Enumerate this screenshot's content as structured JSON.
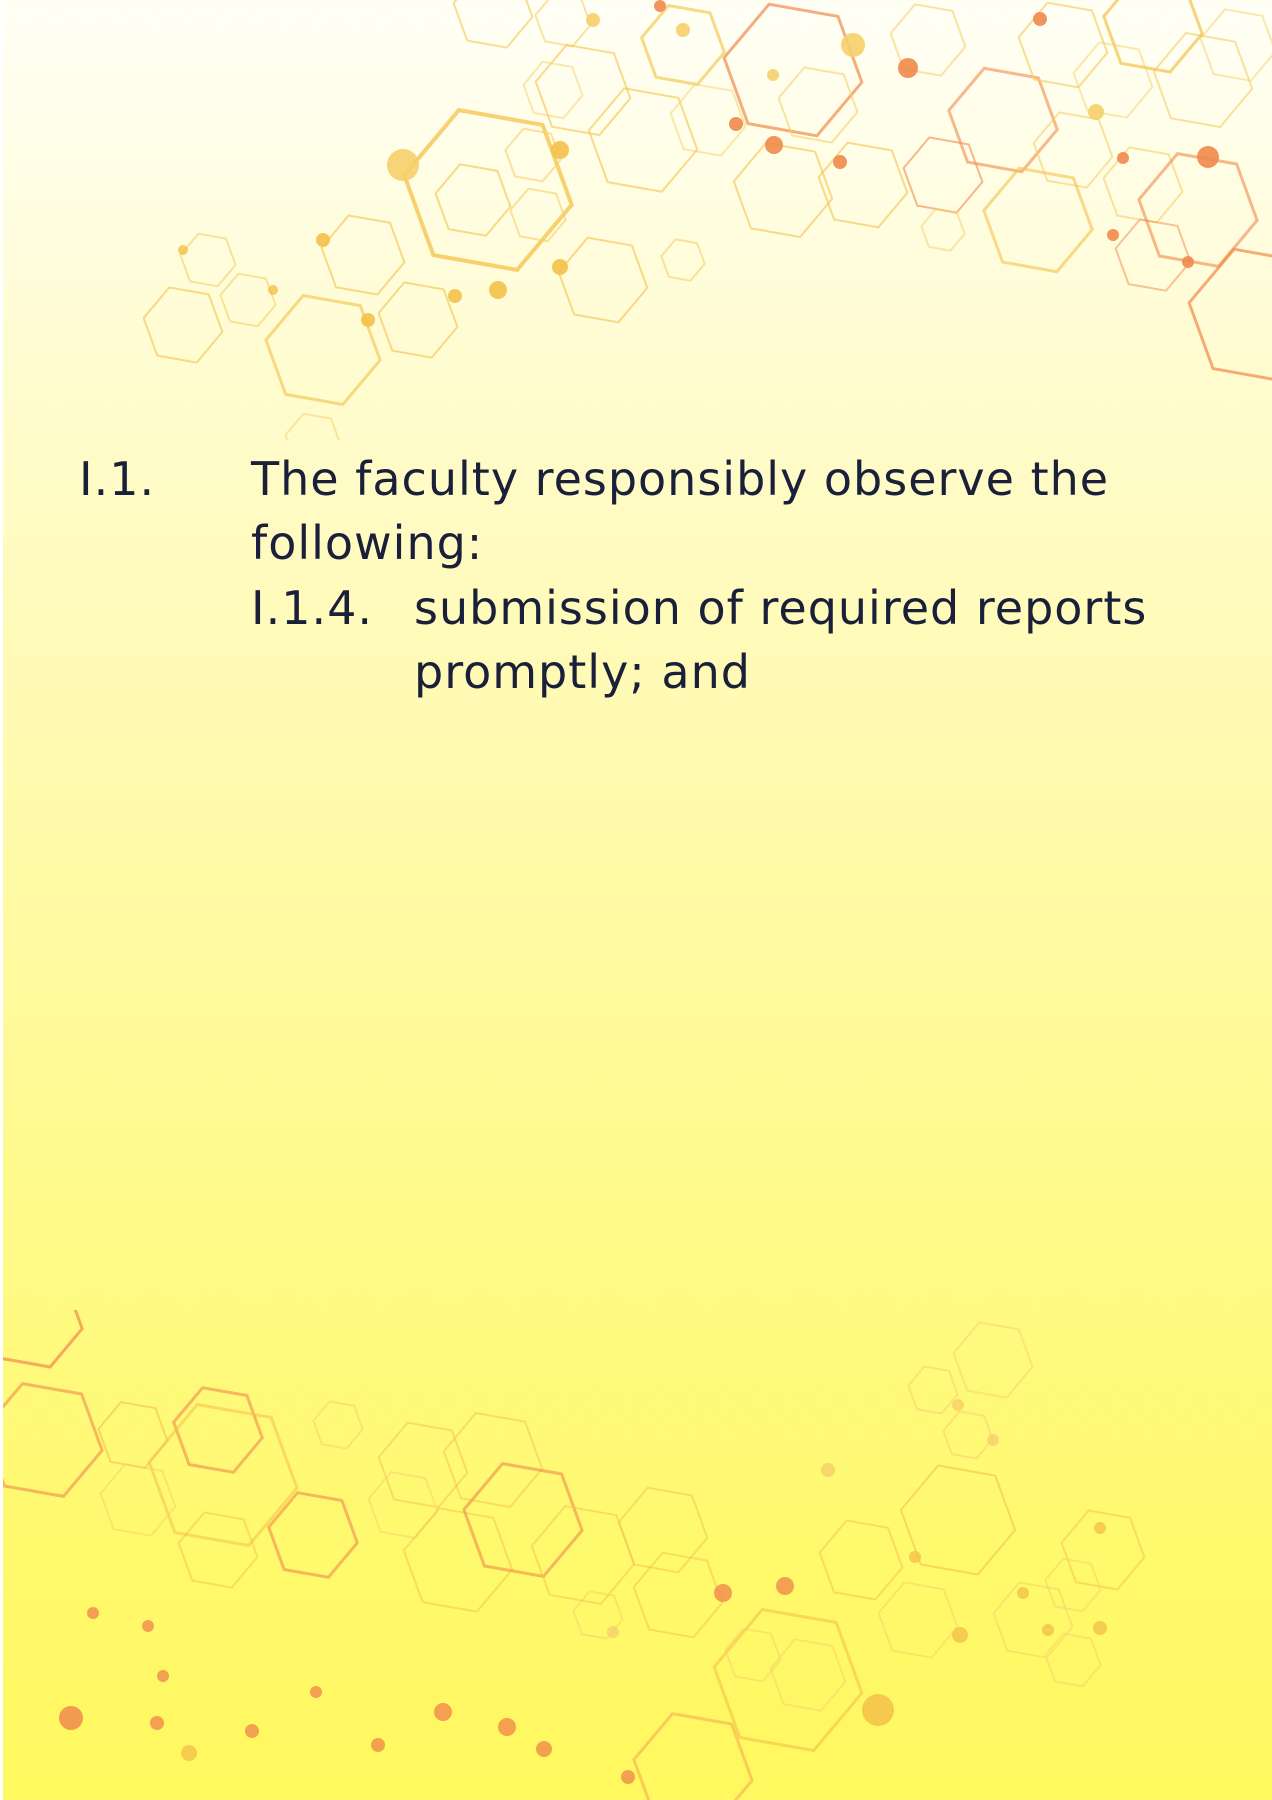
{
  "document": {
    "item": {
      "number": "I.1.",
      "text_line1": "The faculty responsibly observe the",
      "text_line2": "following:"
    },
    "subitem": {
      "number": "I.1.4.",
      "text_line1": "submission of required reports",
      "text_line2": "promptly; and"
    }
  },
  "decoration": {
    "pattern": "hexagon-network",
    "colors": {
      "yellow": "#f4c14a",
      "light_yellow": "#f6cf6a",
      "orange": "#f08a4b",
      "text": "#1a1f3a"
    }
  }
}
